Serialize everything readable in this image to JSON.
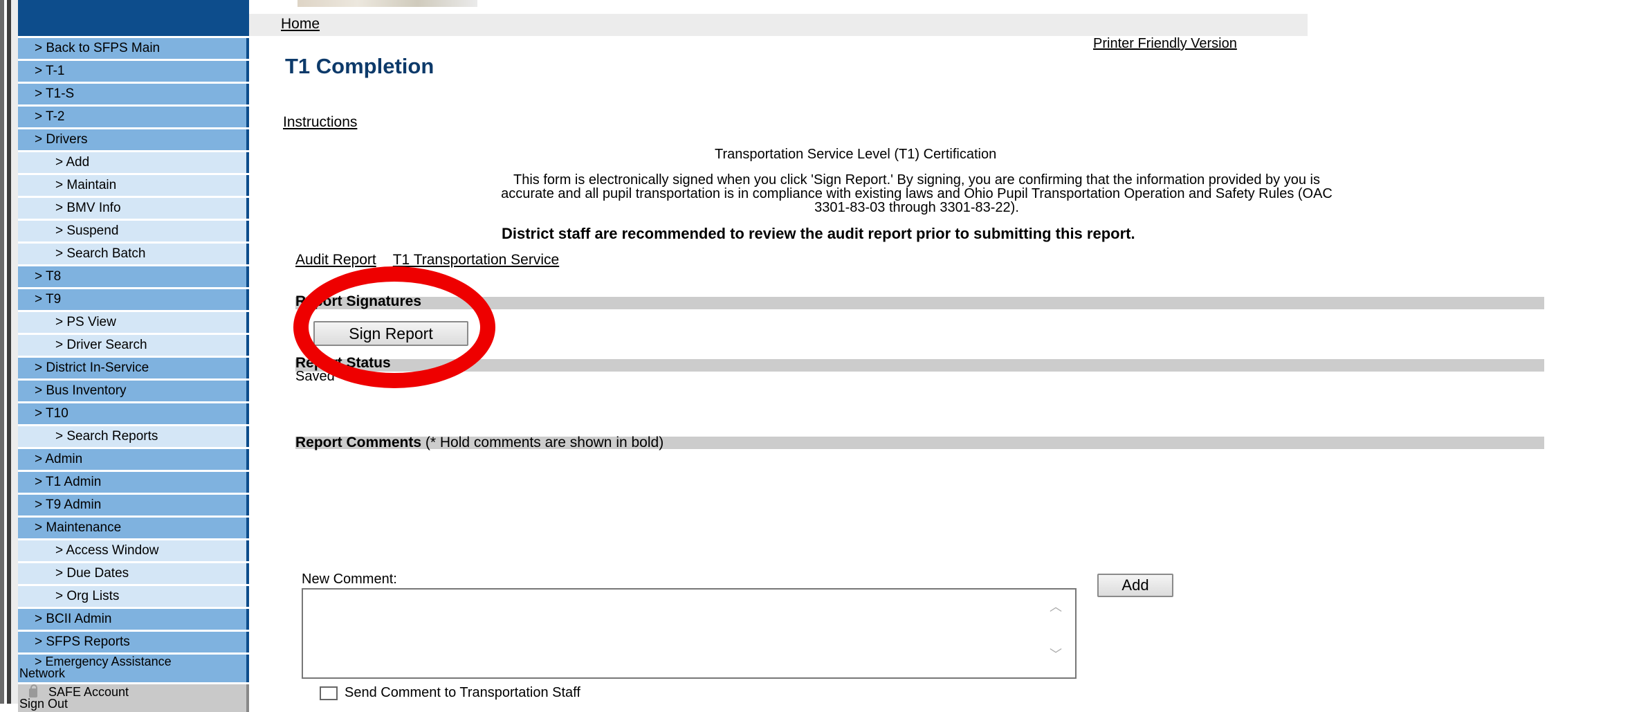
{
  "breadcrumb": {
    "home": "Home"
  },
  "printer_friendly": "Printer Friendly Version",
  "page_title": "T1 Completion",
  "instructions_link": "Instructions",
  "certification": {
    "title": "Transportation Service Level (T1) Certification",
    "line1": "This form is electronically signed when you click 'Sign Report.'  By signing, you are confirming that the information provided by you is",
    "line2": "accurate and all pupil transportation is in compliance with existing laws and Ohio Pupil Transportation Operation and Safety Rules (OAC",
    "line3": "3301-83-03 through 3301-83-22).",
    "note": "District staff are recommended to review the audit report prior to submitting this report."
  },
  "audit_links": {
    "audit_report": "Audit Report",
    "t1_service": "T1 Transportation Service"
  },
  "signatures": {
    "label": "Report Signatures",
    "sign_button": "Sign Report"
  },
  "status": {
    "label": "Report Status",
    "value": "Saved"
  },
  "comments": {
    "label": "Report Comments",
    "note": "(* Hold comments are shown in bold)",
    "new_label": "New Comment:",
    "add_button": "Add",
    "send_label": "Send Comment to Transportation Staff"
  },
  "sidebar": {
    "items": [
      {
        "label": "> Back to SFPS Main",
        "level": 1
      },
      {
        "label": "> T-1",
        "level": 1
      },
      {
        "label": "> T1-S",
        "level": 1
      },
      {
        "label": "> T-2",
        "level": 1
      },
      {
        "label": "> Drivers",
        "level": 1
      },
      {
        "label": "> Add",
        "level": 2
      },
      {
        "label": "> Maintain",
        "level": 2
      },
      {
        "label": "> BMV Info",
        "level": 2
      },
      {
        "label": "> Suspend",
        "level": 2
      },
      {
        "label": "> Search Batch",
        "level": 2
      },
      {
        "label": "> T8",
        "level": 1
      },
      {
        "label": "> T9",
        "level": 1
      },
      {
        "label": "> PS View",
        "level": 2
      },
      {
        "label": "> Driver Search",
        "level": 2
      },
      {
        "label": "> District In-Service",
        "level": 1
      },
      {
        "label": "> Bus Inventory",
        "level": 1
      },
      {
        "label": "> T10",
        "level": 1
      },
      {
        "label": "> Search Reports",
        "level": 2
      },
      {
        "label": "> Admin",
        "level": 1
      },
      {
        "label": "> T1 Admin",
        "level": 1
      },
      {
        "label": "> T9 Admin",
        "level": 1
      },
      {
        "label": "> Maintenance",
        "level": 1
      },
      {
        "label": "> Access Window",
        "level": 2
      },
      {
        "label": "> Due Dates",
        "level": 2
      },
      {
        "label": "> Org Lists",
        "level": 2
      },
      {
        "label": "> BCII Admin",
        "level": 1
      },
      {
        "label": "> SFPS Reports",
        "level": 1
      }
    ],
    "emergency": {
      "line1": "> Emergency Assistance",
      "line2": "Network"
    },
    "account": {
      "line1": "SAFE Account",
      "line2": "Sign Out"
    }
  },
  "colors": {
    "sidebar_dark": "#0d4d8c",
    "sidebar_l1": "#7fb2df",
    "sidebar_l2": "#d4e6f6",
    "title": "#0d3a6a",
    "highlight_circle": "#ee0000"
  }
}
